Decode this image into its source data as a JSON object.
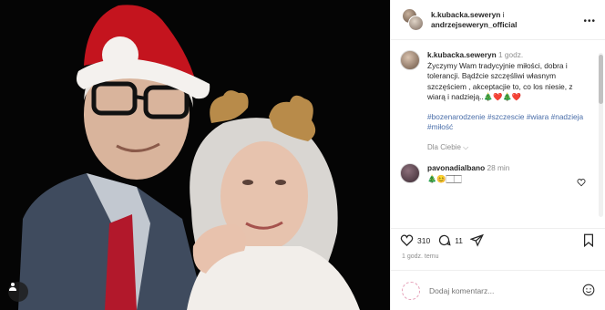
{
  "photo": {
    "alt_subject": "",
    "user_tag_icon": "person-tag-icon"
  },
  "header": {
    "username_primary": "k.kubacka.seweryn",
    "separator": "i",
    "username_secondary": "andrzejseweryn_official",
    "more_icon": "more-horizontal-icon"
  },
  "caption": {
    "username": "k.kubacka.seweryn",
    "time": "1 godz.",
    "text": "Życzymy Wam tradycyjnie miłości, dobra i tolerancji. Bądźcie szczęśliwi własnym szczęściem , akceptacjie to, co los niesie, z wiarą i nadzieją..🎄❤️🎄❤️",
    "hashtags": "#bozenarodzenie #szczescie #wiara #nadzieja #miłość",
    "translate_label": "Dla Ciebie ⌵"
  },
  "comment": {
    "username": "pavonadialbano",
    "time": "28 min",
    "text": "🎄😊🏻🏻"
  },
  "actions": {
    "like_count": "310",
    "comment_count": "11",
    "timestamp": "1 godz. temu"
  },
  "add_comment": {
    "placeholder": "Dodaj komentarz..."
  },
  "colors": {
    "hashtag": "#4a6ea9",
    "muted": "#8e8e8e",
    "text": "#262626",
    "like_heart": "#ed4956"
  }
}
